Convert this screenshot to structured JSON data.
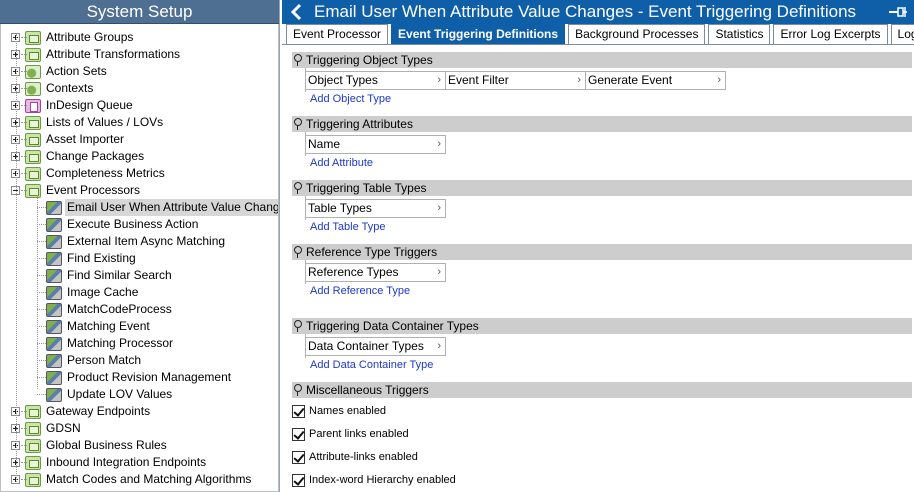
{
  "left_panel": {
    "title": "System Setup",
    "tree": [
      {
        "label": "Attribute Groups",
        "icon": "folder-icon",
        "level": 0,
        "expander": "plus"
      },
      {
        "label": "Attribute Transformations",
        "icon": "folder-icon",
        "level": 0,
        "expander": "plus"
      },
      {
        "label": "Action Sets",
        "icon": "action-set-icon",
        "level": 0,
        "expander": "plus"
      },
      {
        "label": "Contexts",
        "icon": "contexts-icon",
        "level": 0,
        "expander": "plus"
      },
      {
        "label": "InDesign Queue",
        "icon": "indesign-queue-icon",
        "level": 0,
        "expander": "plus"
      },
      {
        "label": "Lists of Values / LOVs",
        "icon": "folder-icon",
        "level": 0,
        "expander": "plus"
      },
      {
        "label": "Asset Importer",
        "icon": "folder-icon",
        "level": 0,
        "expander": "plus"
      },
      {
        "label": "Change Packages",
        "icon": "folder-icon",
        "level": 0,
        "expander": "plus"
      },
      {
        "label": "Completeness Metrics",
        "icon": "folder-icon",
        "level": 0,
        "expander": "plus"
      },
      {
        "label": "Event Processors",
        "icon": "folder-icon",
        "level": 0,
        "expander": "minus"
      },
      {
        "label": "Email User When Attribute Value Changes",
        "icon": "event-processor-icon",
        "level": 1,
        "selected": true
      },
      {
        "label": "Execute Business Action",
        "icon": "event-processor-icon",
        "level": 1
      },
      {
        "label": "External Item Async Matching",
        "icon": "event-processor-icon",
        "level": 1
      },
      {
        "label": "Find Existing",
        "icon": "event-processor-icon",
        "level": 1
      },
      {
        "label": "Find Similar Search",
        "icon": "event-processor-icon",
        "level": 1
      },
      {
        "label": "Image Cache",
        "icon": "event-processor-icon",
        "level": 1
      },
      {
        "label": "MatchCodeProcess",
        "icon": "event-processor-icon",
        "level": 1
      },
      {
        "label": "Matching Event",
        "icon": "event-processor-icon",
        "level": 1
      },
      {
        "label": "Matching Processor",
        "icon": "event-processor-icon",
        "level": 1
      },
      {
        "label": "Person Match",
        "icon": "event-processor-icon",
        "level": 1
      },
      {
        "label": "Product Revision Management",
        "icon": "event-processor-icon",
        "level": 1
      },
      {
        "label": "Update LOV Values",
        "icon": "event-processor-icon",
        "level": 1
      },
      {
        "label": "Gateway Endpoints",
        "icon": "folder-icon",
        "level": 0,
        "expander": "plus"
      },
      {
        "label": "GDSN",
        "icon": "folder-icon",
        "level": 0,
        "expander": "plus"
      },
      {
        "label": "Global Business Rules",
        "icon": "folder-icon",
        "level": 0,
        "expander": "plus"
      },
      {
        "label": "Inbound Integration Endpoints",
        "icon": "folder-icon",
        "level": 0,
        "expander": "plus"
      },
      {
        "label": "Match Codes and Matching Algorithms",
        "icon": "folder-icon",
        "level": 0,
        "expander": "plus"
      }
    ]
  },
  "right_panel": {
    "title": "Email User When Attribute Value Changes - Event Triggering Definitions",
    "tabs": [
      {
        "label": "Event Processor",
        "active": false
      },
      {
        "label": "Event Triggering Definitions",
        "active": true
      },
      {
        "label": "Background Processes",
        "active": false
      },
      {
        "label": "Statistics",
        "active": false
      },
      {
        "label": "Error Log Excerpts",
        "active": false
      },
      {
        "label": "Log",
        "active": false
      }
    ],
    "sections": [
      {
        "title": "Triggering Object Types",
        "columns": [
          "Object Types",
          "Event Filter",
          "Generate Event"
        ],
        "add_link": "Add Object Type"
      },
      {
        "title": "Triggering Attributes",
        "columns": [
          "Name"
        ],
        "add_link": "Add Attribute"
      },
      {
        "title": "Triggering Table Types",
        "columns": [
          "Table Types"
        ],
        "add_link": "Add Table Type"
      },
      {
        "title": "Reference Type Triggers",
        "columns": [
          "Reference Types"
        ],
        "add_link": "Add Reference Type"
      },
      {
        "title": "Triggering Data Container Types",
        "columns": [
          "Data Container Types"
        ],
        "add_link": "Add Data Container Type"
      }
    ],
    "misc": {
      "title": "Miscellaneous Triggers",
      "checkboxes": [
        {
          "label": "Names enabled",
          "checked": true
        },
        {
          "label": "Parent links enabled",
          "checked": true
        },
        {
          "label": "Attribute-links enabled",
          "checked": true
        },
        {
          "label": "Index-word Hierarchy enabled",
          "checked": true
        }
      ]
    }
  }
}
